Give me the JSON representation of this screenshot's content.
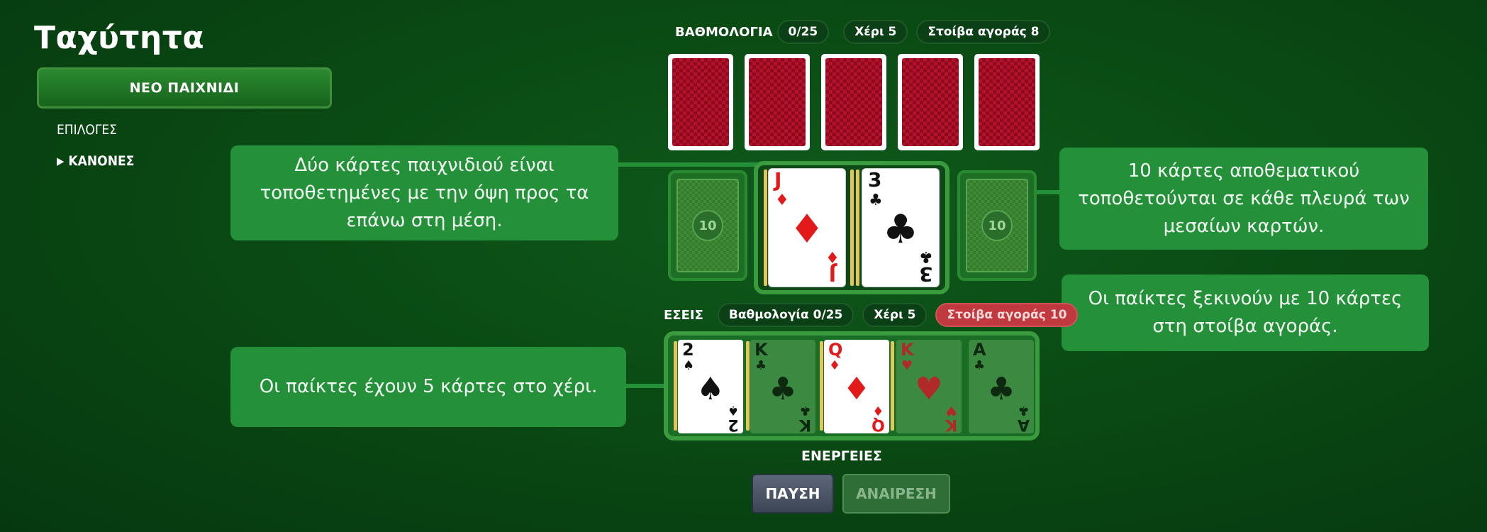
{
  "sidebar": {
    "title": "Ταχύτητα",
    "new_game_label": "ΝΕΟ ΠΑΙΧΝΙΔΙ",
    "options_label": "ΕΠΙΛΟΓΕΣ",
    "rules_arrow": "▶",
    "rules_label": "ΚΑΝΟΝΕΣ"
  },
  "opponent": {
    "label": "ΒΑΘΜΟΛΟΓΙΑ",
    "score": "0/25",
    "hand": "Χέρι 5",
    "draw_pile": "Στοίβα αγοράς 8"
  },
  "player": {
    "label": "ΕΣΕΙΣ",
    "score": "Βαθμολογία 0/25",
    "hand": "Χέρι 5",
    "draw_pile": "Στοίβα αγοράς 10",
    "draw_pile_color": "#c0393f",
    "hand_cards": [
      {
        "rank": "2",
        "suit": "♠",
        "color": "black",
        "active": true
      },
      {
        "rank": "K",
        "suit": "♣",
        "color": "black",
        "active": false
      },
      {
        "rank": "Q",
        "suit": "♦",
        "color": "red",
        "active": true
      },
      {
        "rank": "K",
        "suit": "♥",
        "color": "red",
        "active": false
      },
      {
        "rank": "A",
        "suit": "♣",
        "color": "black",
        "active": false
      }
    ]
  },
  "center": {
    "left_reserve_count": "10",
    "right_reserve_count": "10",
    "left_card": {
      "rank": "J",
      "suit": "♦",
      "color": "red"
    },
    "right_card": {
      "rank": "3",
      "suit": "♣",
      "color": "black"
    }
  },
  "tooltips": {
    "center_cards": "Δύο κάρτες παιχνιδιού είναι τοποθετημένες με την όψη προς τα επάνω στη μέση.",
    "reserve_cards": "10 κάρτες αποθεματικού τοποθετούνται σε κάθε πλευρά των μεσαίων καρτών.",
    "draw_pile": "Οι παίκτες ξεκινούν με 10 κάρτες στη στοίβα αγοράς.",
    "hand": "Οι παίκτες έχουν 5 κάρτες στο χέρι."
  },
  "actions": {
    "label": "ΕΝΕΡΓΕΙΕΣ",
    "pause_label": "ΠΑΥΣΗ",
    "undo_label": "ΑΝΑΙΡΕΣΗ"
  },
  "colors": {
    "felt": "#0a4a14",
    "tooltip": "#249039",
    "card_back": "#b5112b"
  }
}
